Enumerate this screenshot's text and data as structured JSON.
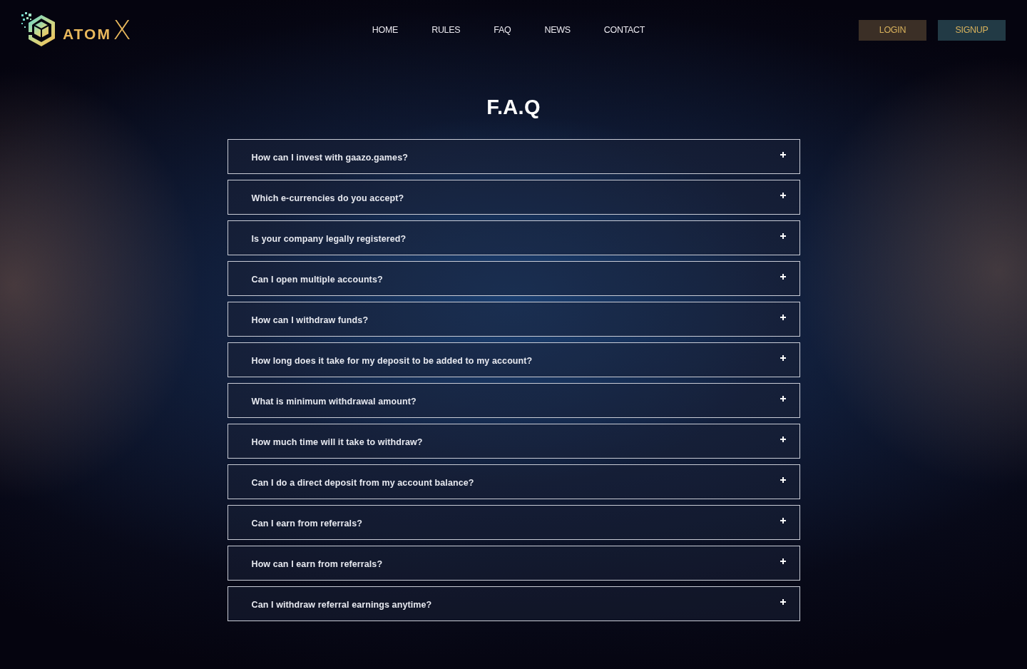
{
  "header": {
    "logo": {
      "text": "ATOM",
      "accent": "X"
    },
    "nav": [
      "HOME",
      "RULES",
      "FAQ",
      "NEWS",
      "CONTACT"
    ],
    "buttons": [
      {
        "label": "LOGIN",
        "kind": "login"
      },
      {
        "label": "SIGNUP",
        "kind": "signup"
      }
    ]
  },
  "faq": {
    "title": "F.A.Q",
    "items": [
      {
        "question": "How can I invest with gaazo.games?",
        "expanded": false
      },
      {
        "question": "Which e-currencies do you accept?",
        "expanded": false
      },
      {
        "question": "Is your company legally registered?",
        "expanded": false
      },
      {
        "question": "Can I open multiple accounts?",
        "expanded": false
      },
      {
        "question": "How can I withdraw funds?",
        "expanded": false
      },
      {
        "question": "How long does it take for my deposit to be added to my account?",
        "expanded": false
      },
      {
        "question": "What is minimum withdrawal amount?",
        "expanded": false
      },
      {
        "question": "How much time will it take to withdraw?",
        "expanded": false
      },
      {
        "question": "Can I do a direct deposit from my account balance?",
        "expanded": false
      },
      {
        "question": "Can I earn from referrals?",
        "expanded": false
      },
      {
        "question": "How can I earn from referrals?",
        "expanded": false
      },
      {
        "question": "Can I withdraw referral earnings anytime?",
        "expanded": false
      }
    ]
  }
}
